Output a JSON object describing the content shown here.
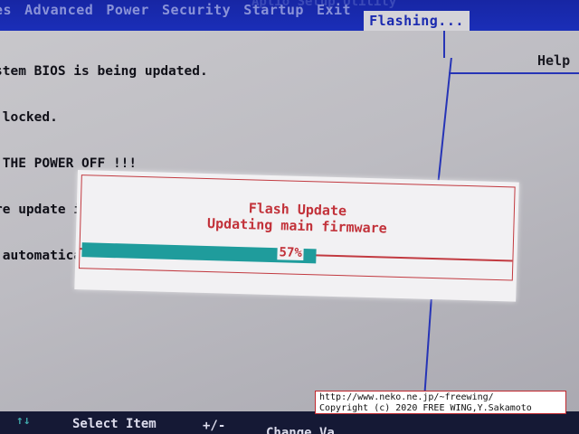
{
  "menubar": {
    "title": "Aptio Setup Utility",
    "items": [
      {
        "label": "es"
      },
      {
        "label": "Advanced"
      },
      {
        "label": "Power"
      },
      {
        "label": "Security"
      },
      {
        "label": "Startup"
      },
      {
        "label": "Exit"
      },
      {
        "label": "Flashing..."
      }
    ],
    "active_index": 6
  },
  "info_lines": [
    "stem BIOS is being updated.",
    " locked.",
    " THE POWER OFF !!!",
    "re update is completed",
    " automatically shut down"
  ],
  "help_label": "Help",
  "dialog": {
    "title": "Flash Update",
    "subtitle": "Updating main firmware",
    "progress_percent": 57,
    "progress_label": "57%"
  },
  "bottom_hints": {
    "keys": "↑↓",
    "select_item": "Select Item",
    "plus_minus": "+/-",
    "change": "Change Va"
  },
  "watermark": {
    "line1": "http://www.neko.ne.jp/~freewing/",
    "line2": "Copyright (c) 2020 FREE WING,Y.Sakamoto"
  },
  "colors": {
    "menubar_blue": "#1a2eb8",
    "accent_red": "#c2323a",
    "progress_teal": "#1f9c9c",
    "panel_gray": "#c2c1c6"
  }
}
